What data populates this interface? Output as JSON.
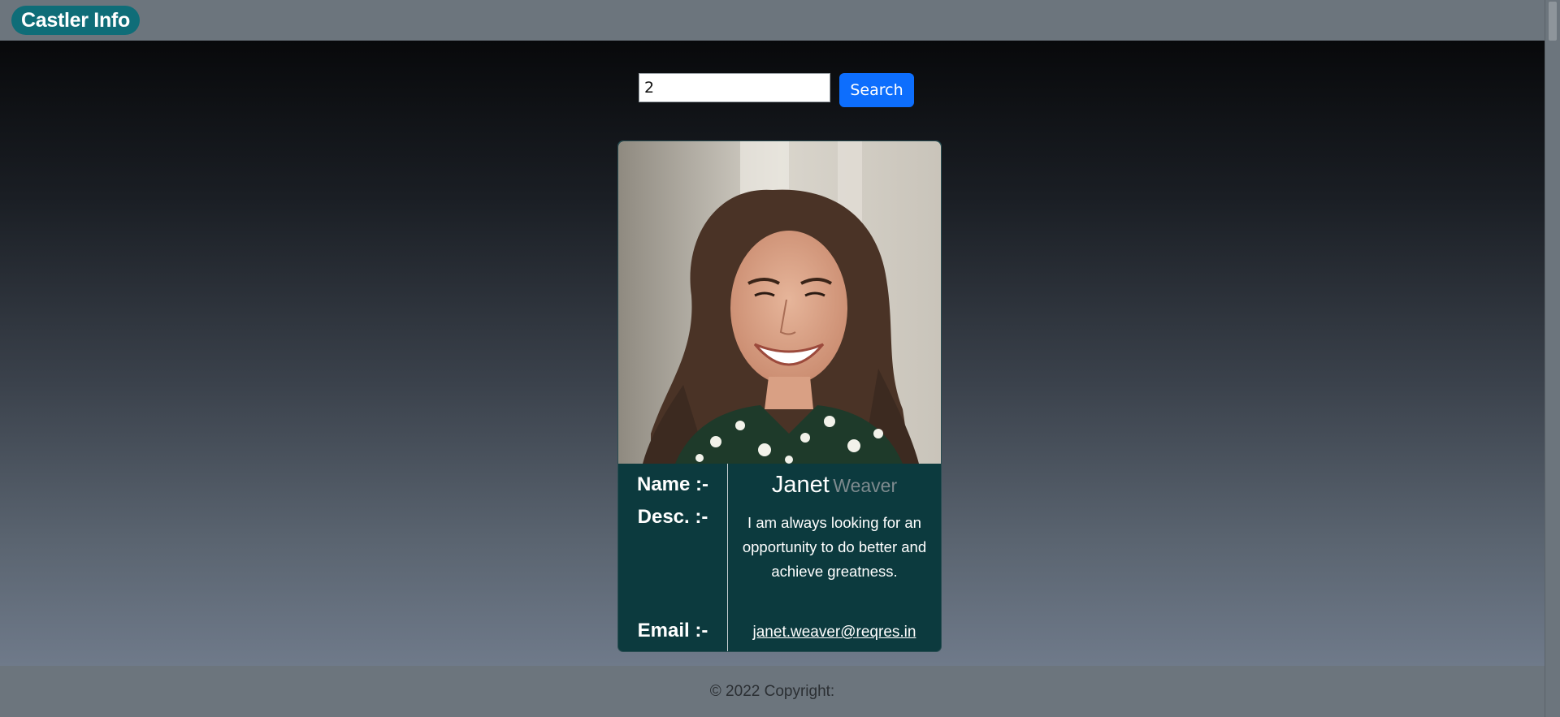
{
  "navbar": {
    "brand": "Castler Info"
  },
  "search": {
    "value": "2",
    "button_label": "Search"
  },
  "card": {
    "name_label": "Name :-",
    "desc_label": "Desc. :-",
    "email_label": "Email :-",
    "first_name": "Janet",
    "last_name": "Weaver",
    "description": "I am always looking for an opportunity to do better and achieve greatness.",
    "email": "janet.weaver@reqres.in"
  },
  "footer": {
    "copyright": "© 2022 Copyright:"
  },
  "colors": {
    "brand_bg": "#0f6d78",
    "card_bg": "#0c3a3e",
    "button_bg": "#0d6efd",
    "chrome_bg": "#6c757d"
  }
}
